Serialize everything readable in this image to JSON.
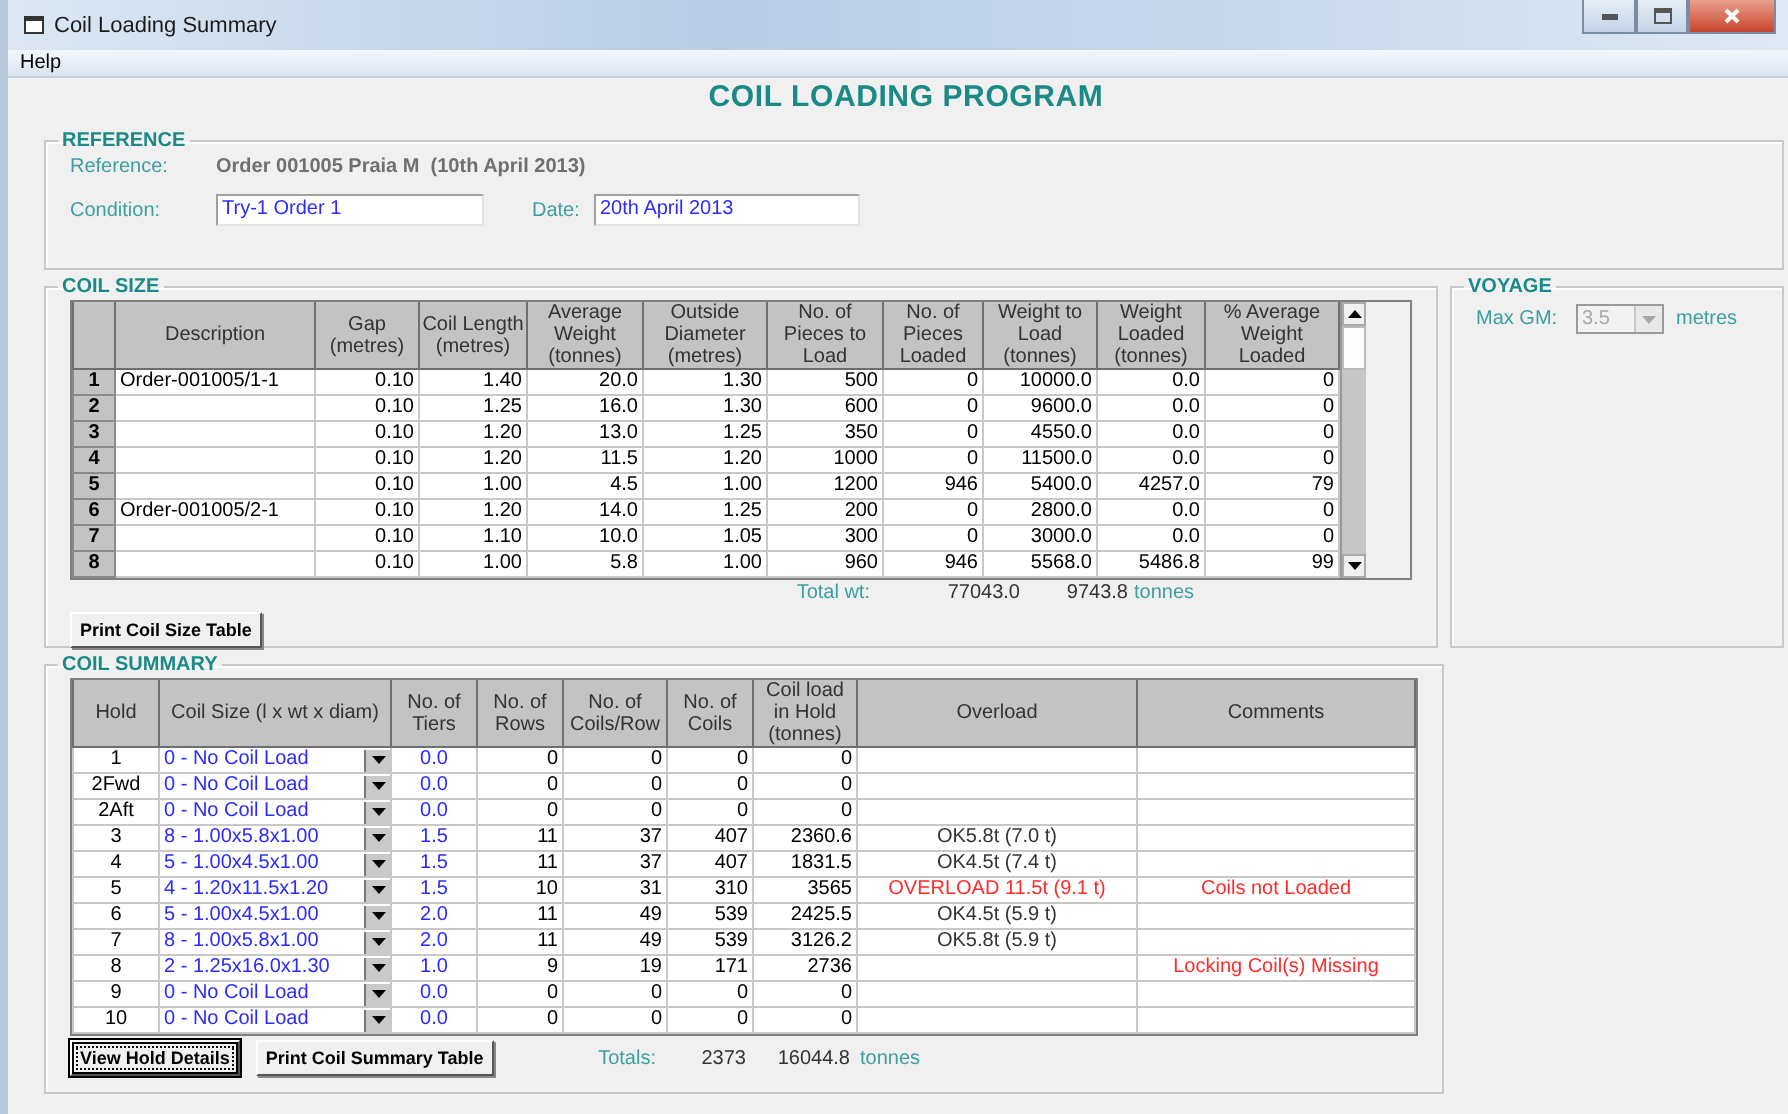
{
  "window": {
    "title": "Coil Loading Summary"
  },
  "menu": [
    "Help"
  ],
  "heading": "COIL LOADING PROGRAM",
  "reference": {
    "legend": "REFERENCE",
    "reference_label": "Reference:",
    "reference_value": "Order 001005 Praia M  (10th April 2013)",
    "condition_label": "Condition:",
    "condition_value": "Try-1 Order 1",
    "date_label": "Date:",
    "date_value": "20th April 2013"
  },
  "coil_size": {
    "legend": "COIL SIZE",
    "columns": [
      "",
      "Description",
      "Gap (metres)",
      "Coil Length (metres)",
      "Average Weight (tonnes)",
      "Outside Diameter (metres)",
      "No. of Pieces to Load",
      "No. of Pieces Loaded",
      "Weight to Load (tonnes)",
      "Weight Loaded (tonnes)",
      "% Average Weight Loaded"
    ],
    "rows": [
      {
        "cells": [
          "1",
          "Order-001005/1-1",
          "0.10",
          "1.40",
          "20.0",
          "1.30",
          "500",
          "0",
          "10000.0",
          "0.0",
          "0"
        ]
      },
      {
        "cells": [
          "2",
          "",
          "0.10",
          "1.25",
          "16.0",
          "1.30",
          "600",
          "0",
          "9600.0",
          "0.0",
          "0"
        ]
      },
      {
        "cells": [
          "3",
          "",
          "0.10",
          "1.20",
          "13.0",
          "1.25",
          "350",
          "0",
          "4550.0",
          "0.0",
          "0"
        ]
      },
      {
        "cells": [
          "4",
          "",
          "0.10",
          "1.20",
          "11.5",
          "1.20",
          "1000",
          "0",
          "11500.0",
          "0.0",
          "0"
        ]
      },
      {
        "cells": [
          "5",
          "",
          "0.10",
          "1.00",
          "4.5",
          "1.00",
          "1200",
          "946",
          "5400.0",
          "4257.0",
          "79"
        ]
      },
      {
        "cells": [
          "6",
          "Order-001005/2-1",
          "0.10",
          "1.20",
          "14.0",
          "1.25",
          "200",
          "0",
          "2800.0",
          "0.0",
          "0"
        ]
      },
      {
        "cells": [
          "7",
          "",
          "0.10",
          "1.10",
          "10.0",
          "1.05",
          "300",
          "0",
          "3000.0",
          "0.0",
          "0"
        ]
      },
      {
        "cells": [
          "8",
          "",
          "0.10",
          "1.00",
          "5.8",
          "1.00",
          "960",
          "946",
          "5568.0",
          "5486.8",
          "99"
        ]
      }
    ],
    "total_label": "Total wt:",
    "total_weight_to_load": "77043.0",
    "total_weight_loaded": "9743.8",
    "total_unit": "tonnes",
    "print_button": "Print Coil Size Table"
  },
  "voyage": {
    "legend": "VOYAGE",
    "max_gm_label": "Max GM:",
    "max_gm_value": "3.5",
    "max_gm_disabled": true,
    "unit": "metres"
  },
  "coil_summary": {
    "legend": "COIL SUMMARY",
    "columns": [
      "Hold",
      "Coil Size (l x wt x diam)",
      "No. of Tiers",
      "No. of Rows",
      "No. of Coils/Row",
      "No. of Coils",
      "Coil load in Hold (tonnes)",
      "Overload",
      "Comments"
    ],
    "rows": [
      {
        "cells": [
          "1",
          "0 - No Coil Load",
          "0.0",
          "0",
          "0",
          "0",
          "0",
          "",
          ""
        ]
      },
      {
        "cells": [
          "2Fwd",
          "0 - No Coil Load",
          "0.0",
          "0",
          "0",
          "0",
          "0",
          "",
          ""
        ]
      },
      {
        "cells": [
          "2Aft",
          "0 - No Coil Load",
          "0.0",
          "0",
          "0",
          "0",
          "0",
          "",
          ""
        ]
      },
      {
        "cells": [
          "3",
          "8 - 1.00x5.8x1.00",
          "1.5",
          "11",
          "37",
          "407",
          "2360.6",
          "OK5.8t (7.0 t)",
          ""
        ],
        "overload_alert": false
      },
      {
        "cells": [
          "4",
          "5 - 1.00x4.5x1.00",
          "1.5",
          "11",
          "37",
          "407",
          "1831.5",
          "OK4.5t (7.4 t)",
          ""
        ],
        "overload_alert": false
      },
      {
        "cells": [
          "5",
          "4 - 1.20x11.5x1.20",
          "1.5",
          "10",
          "31",
          "310",
          "3565",
          "OVERLOAD 11.5t (9.1 t)",
          "Coils not Loaded"
        ],
        "overload_alert": true
      },
      {
        "cells": [
          "6",
          "5 - 1.00x4.5x1.00",
          "2.0",
          "11",
          "49",
          "539",
          "2425.5",
          "OK4.5t (5.9 t)",
          ""
        ],
        "overload_alert": false
      },
      {
        "cells": [
          "7",
          "8 - 1.00x5.8x1.00",
          "2.0",
          "11",
          "49",
          "539",
          "3126.2",
          "OK5.8t (5.9 t)",
          ""
        ],
        "overload_alert": false
      },
      {
        "cells": [
          "8",
          "2 - 1.25x16.0x1.30",
          "1.0",
          "9",
          "19",
          "171",
          "2736",
          "",
          "Locking Coil(s) Missing"
        ]
      },
      {
        "cells": [
          "9",
          "0 - No Coil Load",
          "0.0",
          "0",
          "0",
          "0",
          "0",
          "",
          ""
        ]
      },
      {
        "cells": [
          "10",
          "0 - No Coil Load",
          "0.0",
          "0",
          "0",
          "0",
          "0",
          "",
          ""
        ]
      }
    ],
    "buttons": [
      {
        "label": "View Hold Details",
        "focused": true
      },
      {
        "label": "Print Coil Summary Table",
        "focused": false
      }
    ],
    "totals_label": "Totals:",
    "total_coils": "2373",
    "total_load": "16044.8",
    "total_unit": "tonnes"
  }
}
